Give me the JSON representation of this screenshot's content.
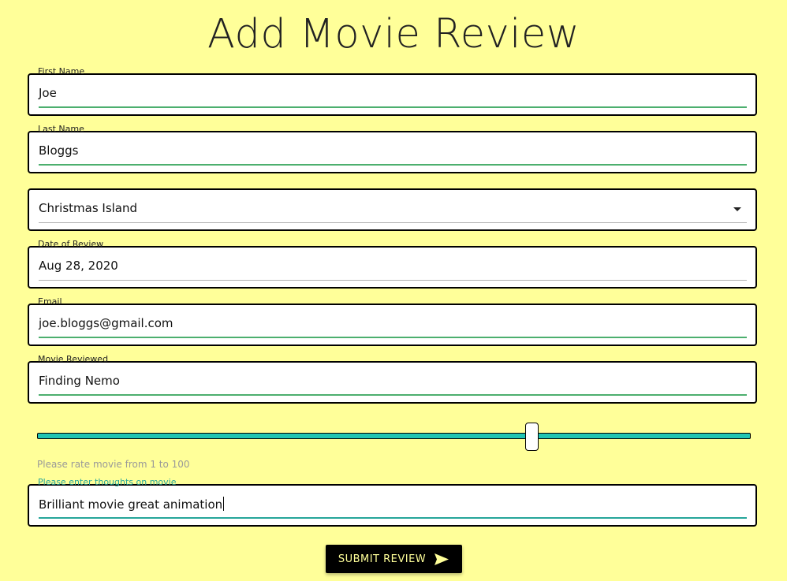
{
  "page": {
    "title": "Add Movie Review"
  },
  "form": {
    "first_name": {
      "label": "First Name",
      "value": "Joe"
    },
    "last_name": {
      "label": "Last Name",
      "value": "Bloggs"
    },
    "country": {
      "value": "Christmas Island",
      "icon": "dropdown-arrow-icon"
    },
    "date_of_review": {
      "label": "Date of Review",
      "value": "Aug 28, 2020"
    },
    "email": {
      "label": "Email",
      "value": "joe.bloggs@gmail.com"
    },
    "movie_reviewed": {
      "label": "Movie Reviewed",
      "value": "Finding Nemo"
    },
    "rating": {
      "help_text": "Please rate movie from 1 to 100",
      "min": 1,
      "max": 100,
      "value": 70
    },
    "thoughts": {
      "label": "Please enter thoughts on movie",
      "value": "Brilliant movie great animation"
    },
    "submit": {
      "label": "SUBMIT REVIEW",
      "icon": "send-icon"
    }
  },
  "colors": {
    "background": "#ffff99",
    "accent_green": "#4caf6e",
    "accent_teal": "#26a69a",
    "slider": "#20c5b3"
  }
}
